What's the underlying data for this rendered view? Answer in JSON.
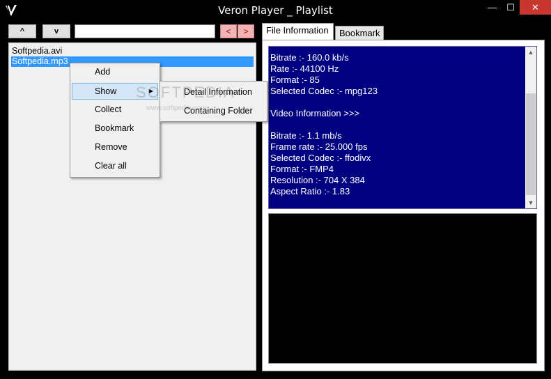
{
  "window": {
    "title": "Veron Player _ Playlist",
    "min_glyph": "—",
    "max_glyph": "☐",
    "close_glyph": "✕"
  },
  "toolbar": {
    "up_label": "^",
    "down_label": "v",
    "search_value": "",
    "prev_label": "<",
    "next_label": ">"
  },
  "playlist": {
    "items": [
      {
        "label": "Softpedia.avi"
      },
      {
        "label": "Softpedia.mp3"
      }
    ],
    "selected_index": 1
  },
  "context_menu": {
    "items": [
      {
        "label": "Add"
      },
      {
        "label": "Show"
      },
      {
        "label": "Collect"
      },
      {
        "label": "Bookmark"
      },
      {
        "label": "Remove"
      },
      {
        "label": "Clear all"
      }
    ],
    "hovered": "Show",
    "submenu_arrow": "▶",
    "submenu": [
      {
        "label": "Detail Information"
      },
      {
        "label": "Containing Folder"
      }
    ]
  },
  "tabs": {
    "file_information": "File Information",
    "bookmark": "Bookmark"
  },
  "info": {
    "lines": [
      "Bitrate :- 160.0 kb/s",
      "Rate :- 44100 Hz",
      "Format :- 85",
      "Selected Codec :- mpg123",
      "",
      "Video Information >>>",
      "",
      "Bitrate :- 1.1 mb/s",
      "Frame rate :- 25.000 fps",
      "Selected Codec :- ffodivx",
      "Format :- FMP4",
      "Resolution :- 704 X 384",
      "Aspect Ratio :- 1.83"
    ]
  },
  "scrollbar": {
    "up_glyph": "▲",
    "down_glyph": "▼"
  },
  "watermark": {
    "text": "SOFTPEDIA",
    "sub": "www.softpedia.com"
  },
  "colors": {
    "info_background": "#000080",
    "selection": "#3399ff",
    "close_button": "#c7372f"
  }
}
